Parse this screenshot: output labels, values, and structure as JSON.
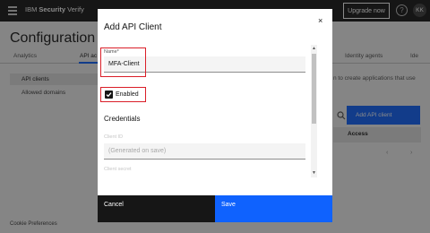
{
  "app": {
    "brand_prefix": "IBM ",
    "brand_bold": "Security",
    "brand_suffix": " Verify",
    "upgrade_label": "Upgrade now",
    "help_glyph": "?",
    "avatar_initials": "KK"
  },
  "page": {
    "title": "Configuration",
    "tabs": [
      {
        "label": "Analytics"
      },
      {
        "label": "API ac"
      },
      {
        "label": "Identity agents"
      },
      {
        "label": "Ide"
      }
    ],
    "sidebar": [
      {
        "label": "API clients",
        "active": true
      },
      {
        "label": "Allowed domains",
        "active": false
      }
    ],
    "description_fragment": "n to create applications that use",
    "add_button_label": "Add API client",
    "table_header_access": "Access",
    "pager_prev": "‹",
    "pager_next": "›",
    "cookie_link": "Cookie Preferences"
  },
  "modal": {
    "title": "Add API Client",
    "close_glyph": "×",
    "name_label": "Name*",
    "name_value": "MFA-Client",
    "enabled_label": "Enabled",
    "enabled_checked": true,
    "credentials_title": "Credentials",
    "client_id_label": "Client ID",
    "client_id_placeholder": "(Generated on save)",
    "client_secret_label": "Client secret",
    "cancel_label": "Cancel",
    "save_label": "Save"
  },
  "colors": {
    "topbar": "#161616",
    "accent_blue": "#0f62fe",
    "highlight_red": "#da1e28",
    "overlay": "rgba(22,22,22,0.5)"
  },
  "icons": [
    "hamburger-menu-icon",
    "help-icon",
    "search-icon",
    "close-icon",
    "checkmark-icon",
    "chevron-left-icon",
    "chevron-right-icon"
  ]
}
